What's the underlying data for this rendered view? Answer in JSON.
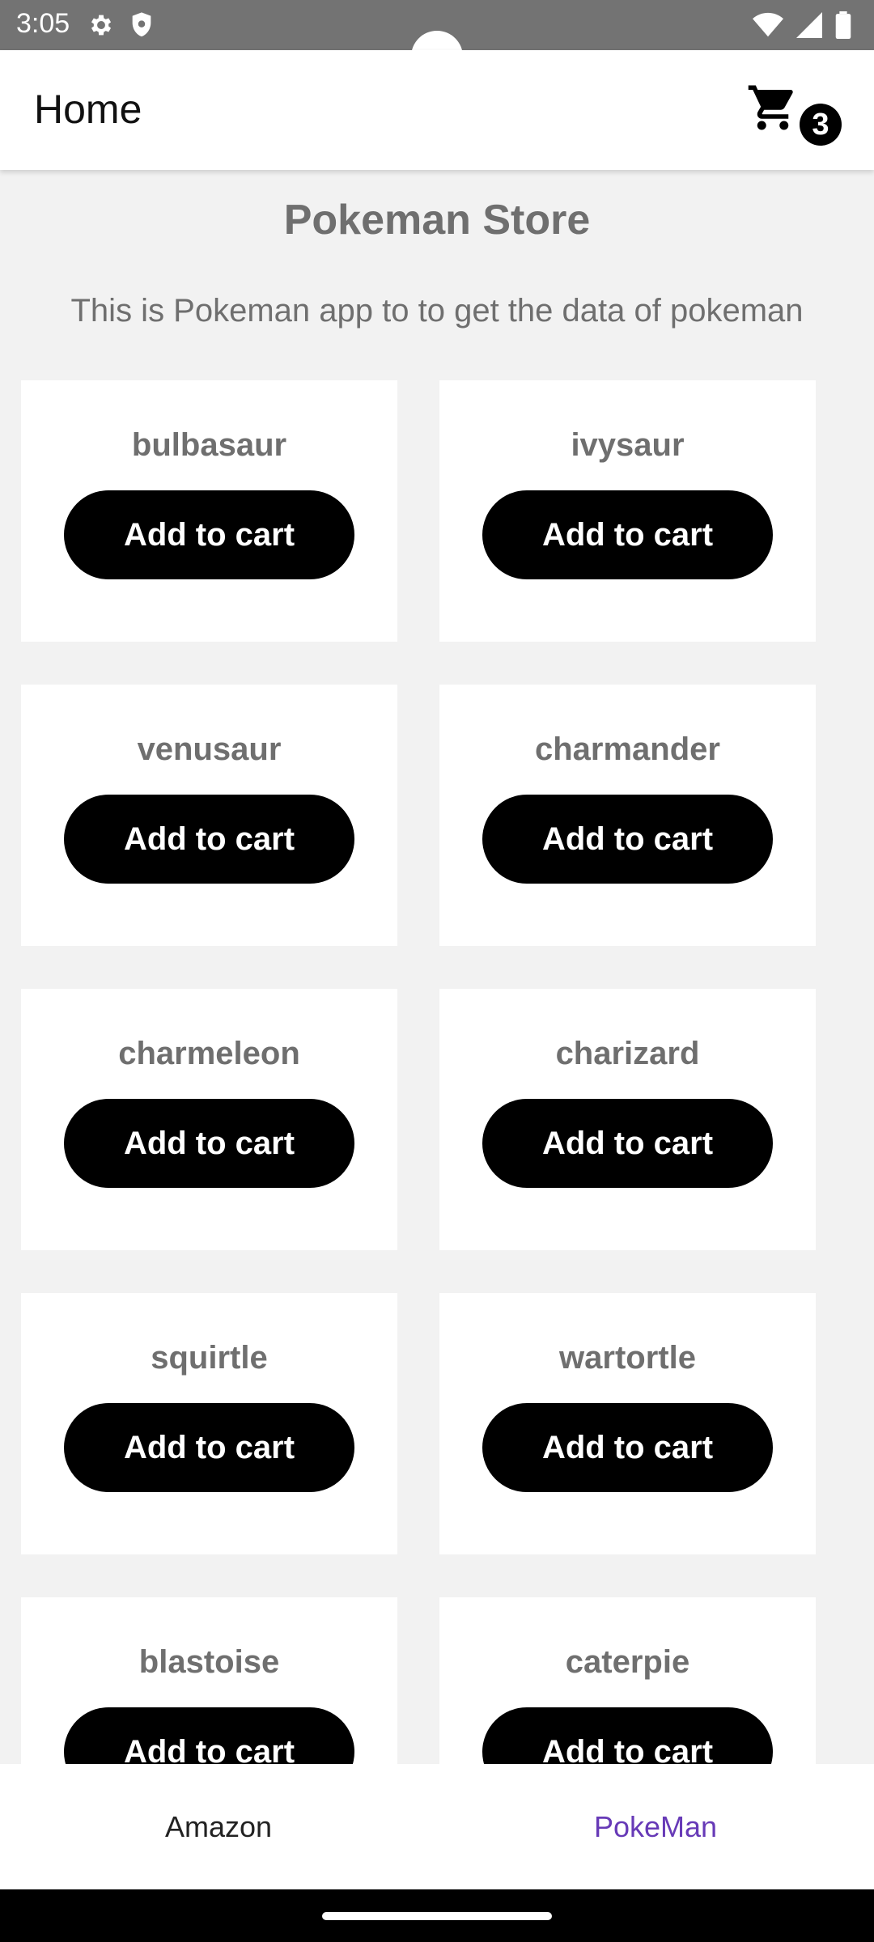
{
  "status_bar": {
    "time": "3:05",
    "icons_left": [
      "gear-icon",
      "shield-icon"
    ],
    "icons_right": [
      "wifi-icon",
      "signal-icon",
      "battery-icon"
    ]
  },
  "app_bar": {
    "title": "Home",
    "cart_count": "3"
  },
  "store": {
    "title": "Pokeman Store",
    "description": "This is Pokeman app to to get the data of pokeman"
  },
  "items": [
    {
      "name": "bulbasaur",
      "button": "Add to cart"
    },
    {
      "name": "ivysaur",
      "button": "Add to cart"
    },
    {
      "name": "venusaur",
      "button": "Add to cart"
    },
    {
      "name": "charmander",
      "button": "Add to cart"
    },
    {
      "name": "charmeleon",
      "button": "Add to cart"
    },
    {
      "name": "charizard",
      "button": "Add to cart"
    },
    {
      "name": "squirtle",
      "button": "Add to cart"
    },
    {
      "name": "wartortle",
      "button": "Add to cart"
    },
    {
      "name": "blastoise",
      "button": "Add to cart"
    },
    {
      "name": "caterpie",
      "button": "Add to cart"
    }
  ],
  "bottom_nav": {
    "tabs": [
      {
        "label": "Amazon",
        "active": false
      },
      {
        "label": "PokeMan",
        "active": true
      }
    ],
    "active_color": "#673ab7"
  }
}
